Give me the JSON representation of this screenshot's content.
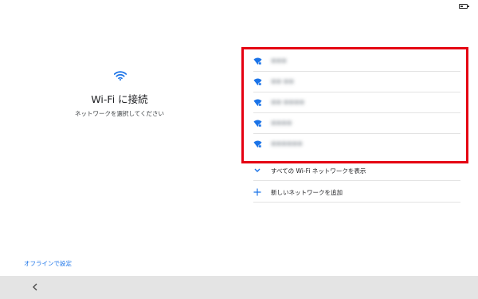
{
  "status": {
    "battery_level": 0.4
  },
  "icons": {
    "wifi": "wifi-icon",
    "wifi_locked": "wifi-lock-icon",
    "expand": "chevron-down-icon",
    "add": "plus-icon",
    "back": "chevron-left-icon",
    "battery": "battery-icon"
  },
  "colors": {
    "accent": "#1a73e8",
    "highlight": "#e50012",
    "nav_bar": "#e4e4e4"
  },
  "setup": {
    "title": "Wi-Fi に接続",
    "subtitle": "ネットワークを選択してください",
    "offline_link": "オフラインで設定"
  },
  "networks": [
    {
      "name": "■■■"
    },
    {
      "name": "■■-■■"
    },
    {
      "name": "■■-■■■■"
    },
    {
      "name": "■■■■"
    },
    {
      "name": "■■■■■■"
    }
  ],
  "actions": {
    "show_all": "すべての Wi-Fi ネットワークを表示",
    "add_network": "新しいネットワークを追加"
  }
}
